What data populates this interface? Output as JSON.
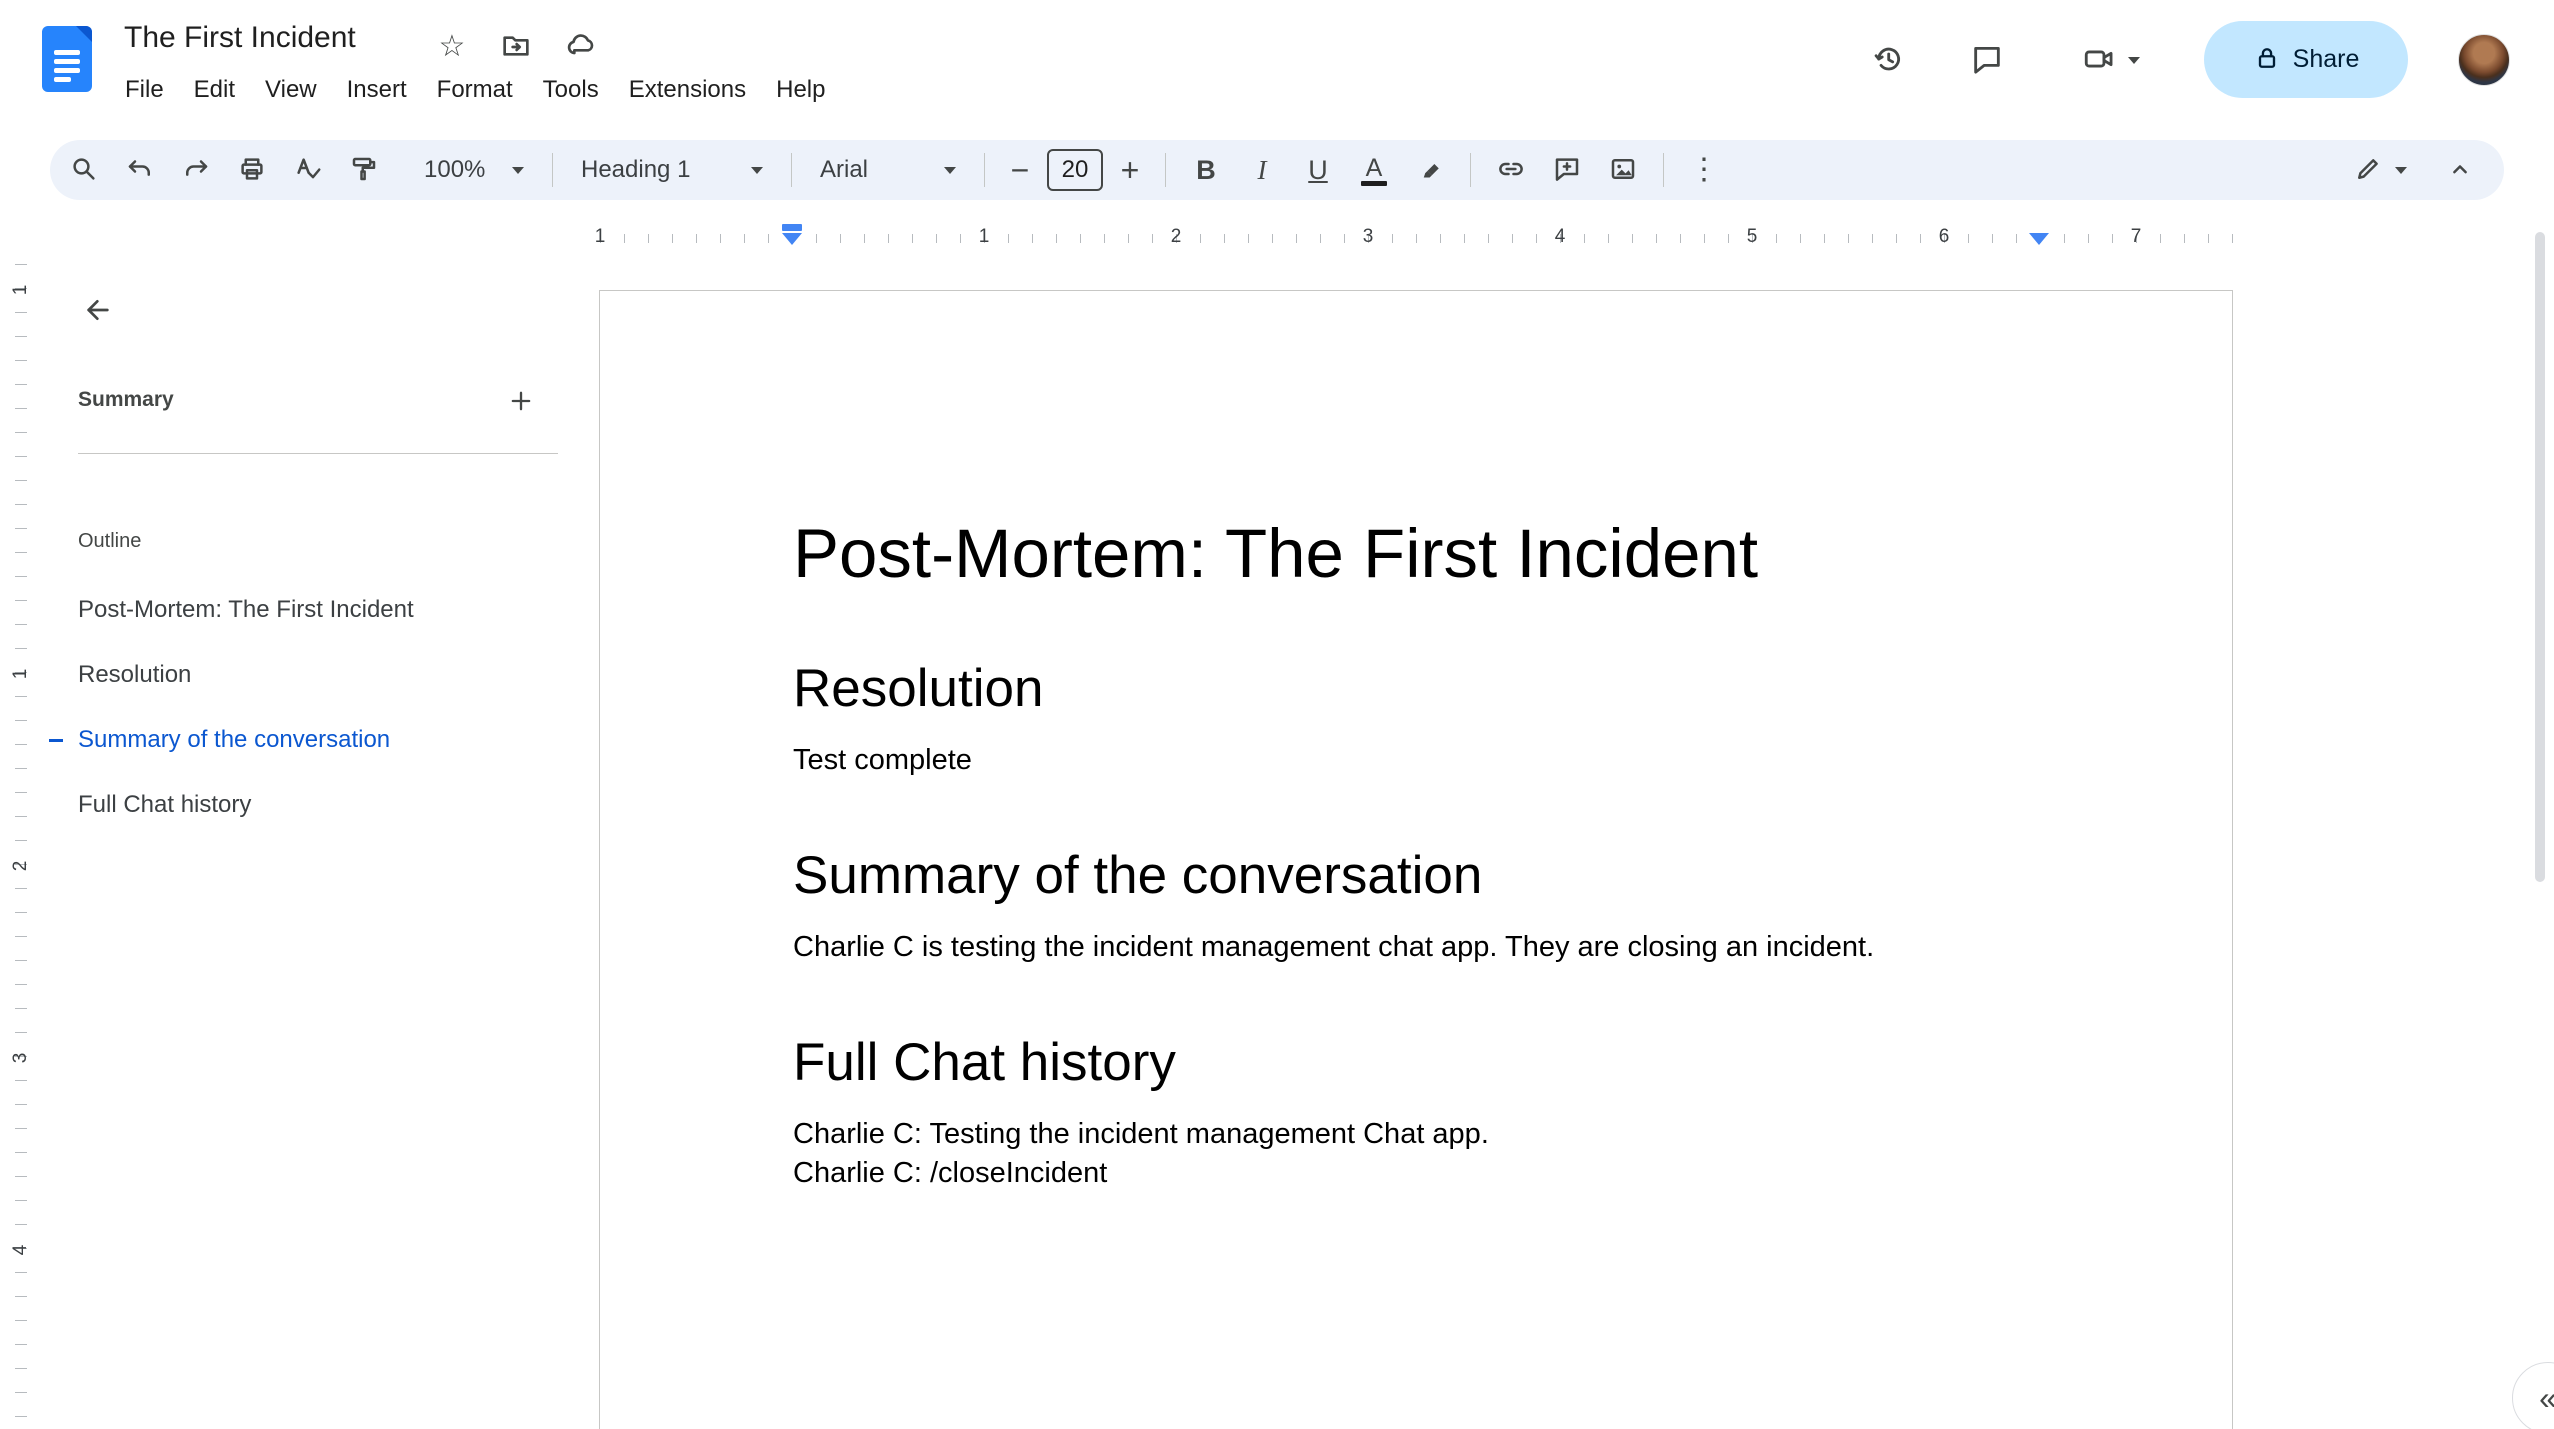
{
  "colors": {
    "toolbar_bg": "#edf2fa",
    "share_bg": "#c2e7ff",
    "share_text": "#001d35",
    "accent_blue": "#4285f4",
    "active_outline": "#0b57d0",
    "icon_gray": "#444746",
    "docs_logo_blue": "#2684fc"
  },
  "header": {
    "doc_title": "The First Incident",
    "star": "☆",
    "menus": [
      "File",
      "Edit",
      "View",
      "Insert",
      "Format",
      "Tools",
      "Extensions",
      "Help"
    ],
    "share_label": "Share"
  },
  "toolbar": {
    "zoom_value": "100%",
    "paragraph_style": "Heading 1",
    "font_family": "Arial",
    "font_size": "20",
    "decrease_label": "−",
    "increase_label": "+",
    "bold_label": "B",
    "italic_label": "I",
    "underline_label": "U",
    "text_color_label": "A",
    "more_label": "⋮"
  },
  "ruler": {
    "h_numbers": [
      "1",
      "1",
      "2",
      "3",
      "4",
      "5",
      "6",
      "7"
    ],
    "v_numbers": [
      "1",
      "1",
      "2",
      "3",
      "4"
    ]
  },
  "sidebar": {
    "summary_label": "Summary",
    "outline_label": "Outline",
    "items": [
      {
        "label": "Post-Mortem: The First Incident",
        "active": false
      },
      {
        "label": "Resolution",
        "active": false
      },
      {
        "label": "Summary of the conversation",
        "active": true
      },
      {
        "label": "Full Chat history",
        "active": false
      }
    ]
  },
  "document": {
    "title": "Post-Mortem: The First Incident",
    "sections": [
      {
        "heading": "Resolution",
        "paragraphs": [
          "Test complete"
        ]
      },
      {
        "heading": "Summary of the conversation",
        "paragraphs": [
          "Charlie C is testing the incident management chat app. They are closing an incident."
        ]
      },
      {
        "heading": "Full Chat history",
        "paragraphs": [
          "Charlie C: Testing the incident management Chat app.",
          "Charlie C: /closeIncident"
        ]
      }
    ]
  },
  "misc": {
    "side_expand_label": "«"
  }
}
